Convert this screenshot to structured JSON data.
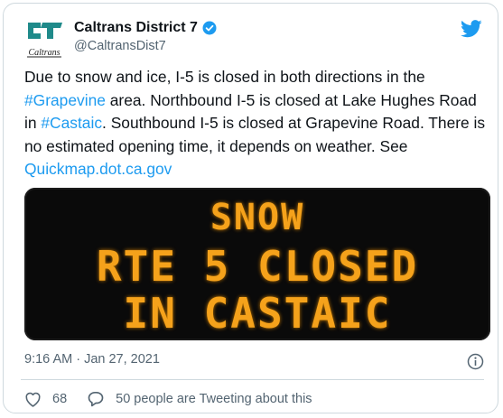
{
  "tweet": {
    "author_name": "Caltrans District 7",
    "handle": "@CaltransDist7",
    "logo_text": "Caltrans",
    "text_parts": {
      "p1": "Due to snow and ice, I-5 is closed in both directions in the ",
      "link1": "#Grapevine",
      "p2": " area. Northbound I-5 is closed at Lake Hughes Road in ",
      "link2": "#Castaic",
      "p3": ". Southbound I-5 is closed at Grapevine Road. There is no estimated opening time, it depends on weather. See ",
      "link3": "Quickmap.dot.ca.gov"
    },
    "sign": {
      "line1": "SNOW",
      "line2": "RTE 5 CLOSED",
      "line3": "IN CASTAIC"
    },
    "timestamp": "9:16 AM · Jan 27, 2021",
    "likes": "68",
    "tweeting": "50 people are Tweeting about this"
  },
  "colors": {
    "accent": "#1d9bf0",
    "sign_text": "#f5a21b",
    "muted": "#536471"
  },
  "icons": [
    "caltrans-logo-icon",
    "verified-badge-icon",
    "twitter-bird-icon",
    "info-icon",
    "heart-icon",
    "reply-bubble-icon"
  ]
}
